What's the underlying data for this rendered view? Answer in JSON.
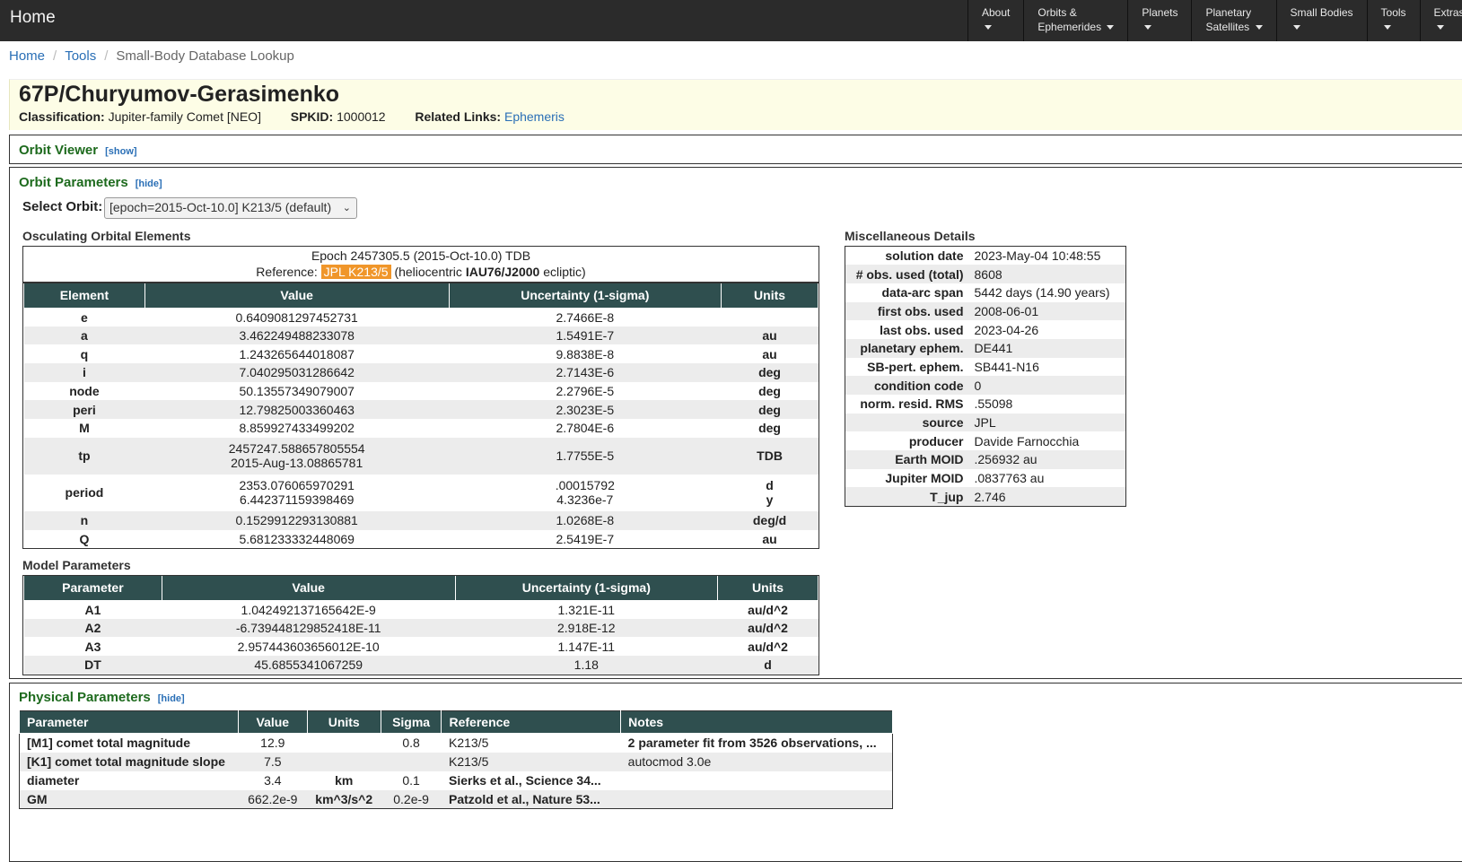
{
  "nav": {
    "home": "Home",
    "items": [
      {
        "line1": "About",
        "line2": ""
      },
      {
        "line1": "Orbits &",
        "line2": "Ephemerides"
      },
      {
        "line1": "Planets",
        "line2": ""
      },
      {
        "line1": "Planetary",
        "line2": "Satellites"
      },
      {
        "line1": "Small Bodies",
        "line2": ""
      },
      {
        "line1": "Tools",
        "line2": ""
      },
      {
        "line1": "Extras",
        "line2": ""
      }
    ]
  },
  "breadcrumb": {
    "home": "Home",
    "tools": "Tools",
    "current": "Small-Body Database Lookup"
  },
  "object": {
    "name": "67P/Churyumov-Gerasimenko",
    "classification_label": "Classification:",
    "classification": "Jupiter-family Comet [NEO]",
    "spkid_label": "SPKID:",
    "spkid": "1000012",
    "related_label": "Related Links:",
    "related_link": "Ephemeris"
  },
  "orbit_viewer": {
    "title": "Orbit Viewer",
    "toggle": "[show]"
  },
  "orbit_params": {
    "title": "Orbit Parameters",
    "toggle": "[hide]",
    "select_label": "Select Orbit:",
    "select_value": "[epoch=2015-Oct-10.0] K213/5 (default)",
    "osc_title": "Osculating Orbital Elements",
    "epoch_line": "Epoch 2457305.5 (2015-Oct-10.0) TDB",
    "ref_prefix": "Reference:",
    "ref_value": "JPL K213/5",
    "ref_mid": "(heliocentric",
    "ref_frame": "IAU76/J2000",
    "ref_suffix": "ecliptic)",
    "headers": [
      "Element",
      "Value",
      "Uncertainty (1-sigma)",
      "Units"
    ],
    "rows": [
      {
        "el": "e",
        "value": "0.6409081297452731",
        "unc": "2.7466E-8",
        "unit": ""
      },
      {
        "el": "a",
        "value": "3.462249488233078",
        "unc": "1.5491E-7",
        "unit": "au"
      },
      {
        "el": "q",
        "value": "1.243265644018087",
        "unc": "9.8838E-8",
        "unit": "au"
      },
      {
        "el": "i",
        "value": "7.040295031286642",
        "unc": "2.7143E-6",
        "unit": "deg"
      },
      {
        "el": "node",
        "value": "50.13557349079007",
        "unc": "2.2796E-5",
        "unit": "deg"
      },
      {
        "el": "peri",
        "value": "12.79825003360463",
        "unc": "2.3023E-5",
        "unit": "deg"
      },
      {
        "el": "M",
        "value": "8.859927433499202",
        "unc": "2.7804E-6",
        "unit": "deg"
      }
    ],
    "tp": {
      "el": "tp",
      "value1": "2457247.588657805554",
      "value2": "2015-Aug-13.08865781",
      "unc": "1.7755E-5",
      "unit": "TDB"
    },
    "period": {
      "el": "period",
      "value1": "2353.076065970291",
      "value2": "6.442371159398469",
      "unc1": ".00015792",
      "unc2": "4.3236e-7",
      "unit1": "d",
      "unit2": "y"
    },
    "rows2": [
      {
        "el": "n",
        "value": "0.1529912293130881",
        "unc": "1.0268E-8",
        "unit": "deg/d"
      },
      {
        "el": "Q",
        "value": "5.681233332448069",
        "unc": "2.5419E-7",
        "unit": "au"
      }
    ],
    "model_title": "Model Parameters",
    "model_headers": [
      "Parameter",
      "Value",
      "Uncertainty (1-sigma)",
      "Units"
    ],
    "model_rows": [
      {
        "el": "A1",
        "value": "1.042492137165642E-9",
        "unc": "1.321E-11",
        "unit": "au/d^2"
      },
      {
        "el": "A2",
        "value": "-6.739448129852418E-11",
        "unc": "2.918E-12",
        "unit": "au/d^2"
      },
      {
        "el": "A3",
        "value": "2.957443603656012E-10",
        "unc": "1.147E-11",
        "unit": "au/d^2"
      },
      {
        "el": "DT",
        "value": "45.6855341067259",
        "unc": "1.18",
        "unit": "d"
      }
    ]
  },
  "misc": {
    "title": "Miscellaneous Details",
    "rows": [
      {
        "k": "solution date",
        "v": "2023-May-04 10:48:55"
      },
      {
        "k": "# obs. used (total)",
        "v": "8608"
      },
      {
        "k": "data-arc span",
        "v": "5442 days (14.90 years)"
      },
      {
        "k": "first obs. used",
        "v": "2008-06-01"
      },
      {
        "k": "last obs. used",
        "v": "2023-04-26"
      },
      {
        "k": "planetary ephem.",
        "v": "DE441"
      },
      {
        "k": "SB-pert. ephem.",
        "v": "SB441-N16"
      },
      {
        "k": "condition code",
        "v": "0"
      },
      {
        "k": "norm. resid. RMS",
        "v": ".55098"
      },
      {
        "k": "source",
        "v": "JPL"
      },
      {
        "k": "producer",
        "v": "Davide Farnocchia"
      },
      {
        "k": "Earth MOID",
        "v": ".256932 au"
      },
      {
        "k": "Jupiter MOID",
        "v": ".0837763 au"
      },
      {
        "k": "T_jup",
        "v": "2.746"
      }
    ]
  },
  "physical": {
    "title": "Physical Parameters",
    "toggle": "[hide]",
    "headers": [
      "Parameter",
      "Value",
      "Units",
      "Sigma",
      "Reference",
      "Notes"
    ],
    "rows": [
      {
        "p": "[M1] comet total magnitude",
        "v": "12.9",
        "u": "",
        "s": "0.8",
        "r": "K213/5",
        "n": "2 parameter fit from 3526 observations, ..."
      },
      {
        "p": "[K1] comet total magnitude slope",
        "v": "7.5",
        "u": "",
        "s": "",
        "r": "K213/5",
        "n": "autocmod 3.0e"
      },
      {
        "p": "diameter",
        "v": "3.4",
        "u": "km",
        "s": "0.1",
        "r": "Sierks et al., Science 34...",
        "n": ""
      },
      {
        "p": "GM",
        "v": "662.2e-9",
        "u": "km^3/s^2",
        "s": "0.2e-9",
        "r": "Patzold et al., Nature 53...",
        "n": ""
      }
    ]
  }
}
